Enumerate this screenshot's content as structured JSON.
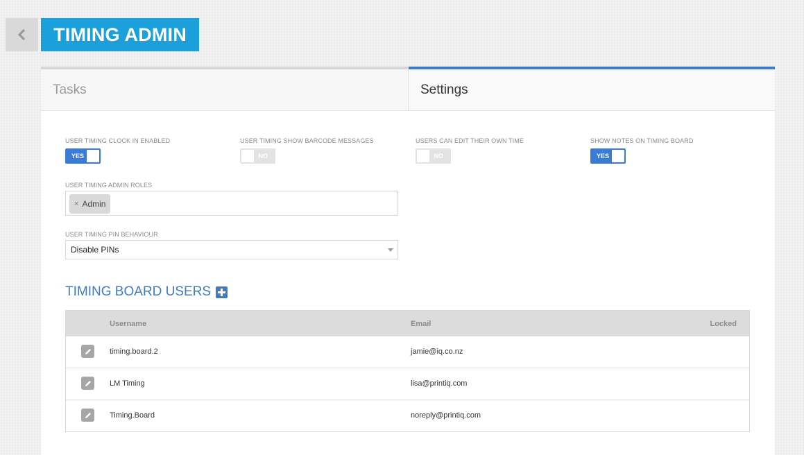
{
  "header": {
    "back_icon": "chevron-left-icon",
    "title": "TIMING ADMIN"
  },
  "tabs": [
    {
      "label": "Tasks",
      "active": false
    },
    {
      "label": "Settings",
      "active": true
    }
  ],
  "settings": {
    "toggles": [
      {
        "label": "USER TIMING CLOCK IN ENABLED",
        "state": "YES",
        "on": true
      },
      {
        "label": "USER TIMING SHOW BARCODE MESSAGES",
        "state": "NO",
        "on": false
      },
      {
        "label": "USERS CAN EDIT THEIR OWN TIME",
        "state": "NO",
        "on": false
      },
      {
        "label": "SHOW NOTES ON TIMING BOARD",
        "state": "YES",
        "on": true
      }
    ],
    "admin_roles": {
      "label": "USER TIMING ADMIN ROLES",
      "chips": [
        "Admin"
      ],
      "remove_glyph": "×"
    },
    "pin_behaviour": {
      "label": "USER TIMING PIN BEHAVIOUR",
      "selected": "Disable PINs"
    }
  },
  "timing_board_users": {
    "heading": "TIMING BOARD USERS",
    "add_icon": "plus-square-icon",
    "columns": {
      "username": "Username",
      "email": "Email",
      "locked": "Locked"
    },
    "rows": [
      {
        "username": "timing.board.2",
        "email": "jamie@iq.co.nz",
        "locked": ""
      },
      {
        "username": "LM Timing",
        "email": "lisa@printiq.com",
        "locked": ""
      },
      {
        "username": "Timing.Board",
        "email": "noreply@printiq.com",
        "locked": ""
      }
    ],
    "row_icon": "pencil-icon"
  },
  "colors": {
    "accent_blue": "#3a7bd5",
    "title_blue": "#1ba0dc",
    "toggle_off": "#e3e3e3"
  }
}
